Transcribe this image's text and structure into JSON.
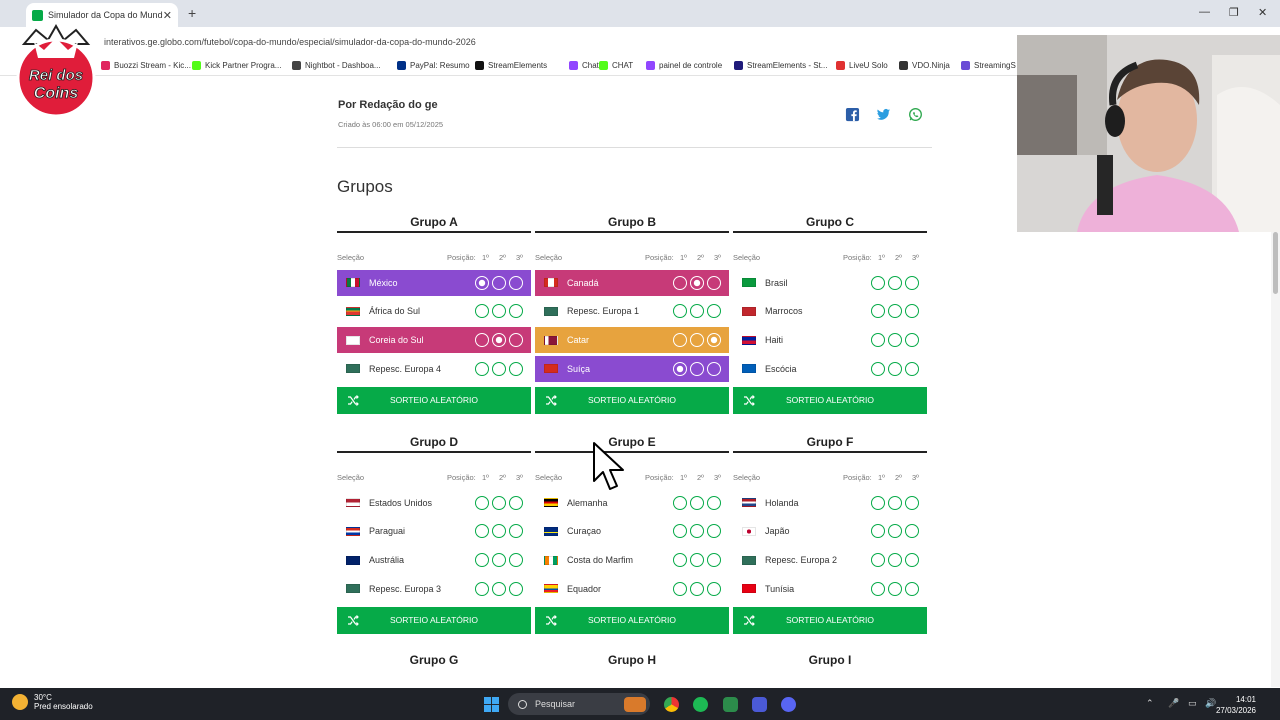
{
  "browser": {
    "tab_title": "Simulador da Copa do Mundo",
    "tab_close": "✕",
    "new_tab": "+",
    "url": "interativos.ge.globo.com/futebol/copa-do-mundo/especial/simulador-da-copa-do-mundo-2026",
    "window": {
      "minimize": "—",
      "restore": "❐",
      "close": "✕"
    },
    "bookmarks": [
      {
        "label": "Buozzi Stream - Kic...",
        "color": "#e0245e"
      },
      {
        "label": "Kick Partner Progra...",
        "color": "#53fc18"
      },
      {
        "label": "Nightbot - Dashboa...",
        "color": "#444444"
      },
      {
        "label": "PayPal: Resumo",
        "color": "#003087"
      },
      {
        "label": "StreamElements",
        "color": "#111111"
      },
      {
        "label": "Chat",
        "color": "#9146ff"
      },
      {
        "label": "CHAT",
        "color": "#53fc18"
      },
      {
        "label": "painel de controle",
        "color": "#9146ff"
      },
      {
        "label": "StreamElements - St...",
        "color": "#1f1a7a"
      },
      {
        "label": "LiveU Solo",
        "color": "#e03131"
      },
      {
        "label": "VDO.Ninja",
        "color": "#333333"
      },
      {
        "label": "StreamingS",
        "color": "#6a4bd6"
      }
    ]
  },
  "overlay": {
    "logo_text_1": "Rei dos",
    "logo_text_2": "Coins"
  },
  "article": {
    "author": "Por Redação do ge",
    "created": "Criado às 06:00 em 05/12/2025",
    "section_title": "Grupos"
  },
  "labels": {
    "selecao": "Seleção",
    "posicao": "Posição:",
    "pos1": "1º",
    "pos2": "2º",
    "pos3": "3º",
    "random_draw": "SORTEIO ALEATÓRIO"
  },
  "groups": [
    {
      "name": "Grupo A",
      "teams": [
        {
          "name": "México",
          "highlight": "#8a4bd0",
          "selected": 1
        },
        {
          "name": "África do Sul",
          "highlight": "",
          "selected": 0
        },
        {
          "name": "Coreia do Sul",
          "highlight": "#c73a78",
          "selected": 2
        },
        {
          "name": "Repesc. Europa 4",
          "highlight": "",
          "selected": 0
        }
      ]
    },
    {
      "name": "Grupo B",
      "teams": [
        {
          "name": "Canadá",
          "highlight": "#c73a78",
          "selected": 2
        },
        {
          "name": "Repesc. Europa 1",
          "highlight": "",
          "selected": 0
        },
        {
          "name": "Catar",
          "highlight": "#e7a33e",
          "selected": 3
        },
        {
          "name": "Suíça",
          "highlight": "#8a4bd0",
          "selected": 1
        }
      ]
    },
    {
      "name": "Grupo C",
      "teams": [
        {
          "name": "Brasil",
          "highlight": "",
          "selected": 0
        },
        {
          "name": "Marrocos",
          "highlight": "",
          "selected": 0
        },
        {
          "name": "Haiti",
          "highlight": "",
          "selected": 0
        },
        {
          "name": "Escócia",
          "highlight": "",
          "selected": 0
        }
      ]
    },
    {
      "name": "Grupo D",
      "teams": [
        {
          "name": "Estados Unidos",
          "highlight": "",
          "selected": 0
        },
        {
          "name": "Paraguai",
          "highlight": "",
          "selected": 0
        },
        {
          "name": "Austrália",
          "highlight": "",
          "selected": 0
        },
        {
          "name": "Repesc. Europa 3",
          "highlight": "",
          "selected": 0
        }
      ]
    },
    {
      "name": "Grupo E",
      "teams": [
        {
          "name": "Alemanha",
          "highlight": "",
          "selected": 0
        },
        {
          "name": "Curaçao",
          "highlight": "",
          "selected": 0
        },
        {
          "name": "Costa do Marfim",
          "highlight": "",
          "selected": 0
        },
        {
          "name": "Equador",
          "highlight": "",
          "selected": 0
        }
      ]
    },
    {
      "name": "Grupo F",
      "teams": [
        {
          "name": "Holanda",
          "highlight": "",
          "selected": 0
        },
        {
          "name": "Japão",
          "highlight": "",
          "selected": 0
        },
        {
          "name": "Repesc. Europa 2",
          "highlight": "",
          "selected": 0
        },
        {
          "name": "Tunísia",
          "highlight": "",
          "selected": 0
        }
      ]
    }
  ],
  "next_groups": [
    "Grupo G",
    "Grupo H",
    "Grupo I"
  ],
  "taskbar": {
    "temperature": "30°C",
    "weather": "Pred ensolarado",
    "search_placeholder": "Pesquisar",
    "time": "14:01",
    "date": "27/03/2026"
  }
}
